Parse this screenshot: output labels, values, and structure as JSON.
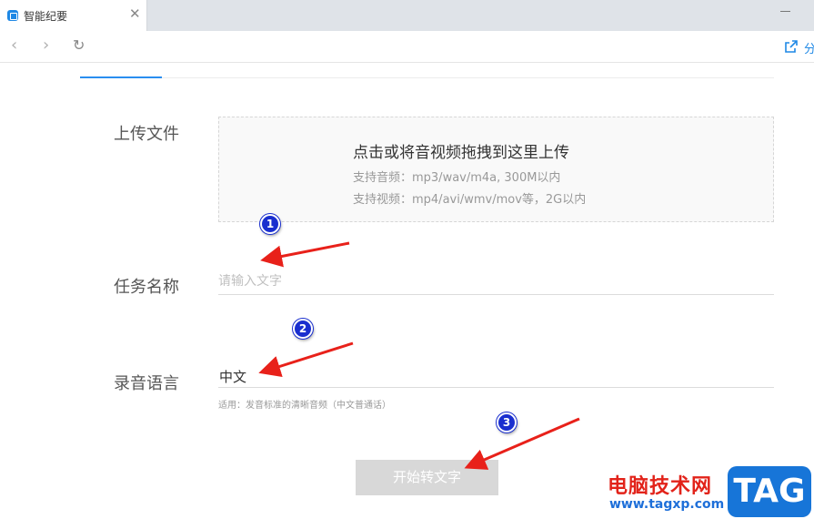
{
  "browser": {
    "tab_title": "智能纪要",
    "tab_close": "✕",
    "nav_back": "‹",
    "nav_forward": "›",
    "nav_refresh": "↻",
    "share_label": "分"
  },
  "form": {
    "upload_label": "上传文件",
    "upload_title": "点击或将音视频拖拽到这里上传",
    "upload_audio_hint": "支持音频：mp3/wav/m4a, 300M以内",
    "upload_video_hint": "支持视频：mp4/avi/wmv/mov等，2G以内",
    "task_label": "任务名称",
    "task_placeholder": "请输入文字",
    "task_value": "",
    "language_label": "录音语言",
    "language_value": "中文",
    "language_hint": "适用：发音标准的清晰音频（中文普通话）",
    "start_button": "开始转文字"
  },
  "annotations": {
    "badges": [
      "1",
      "2",
      "3"
    ],
    "arrow_color": "#e8211a",
    "badge_color": "#1a2fcf"
  },
  "watermark": {
    "text": "电脑技术网",
    "url": "www.tagxp.com",
    "logo": "TAG"
  }
}
